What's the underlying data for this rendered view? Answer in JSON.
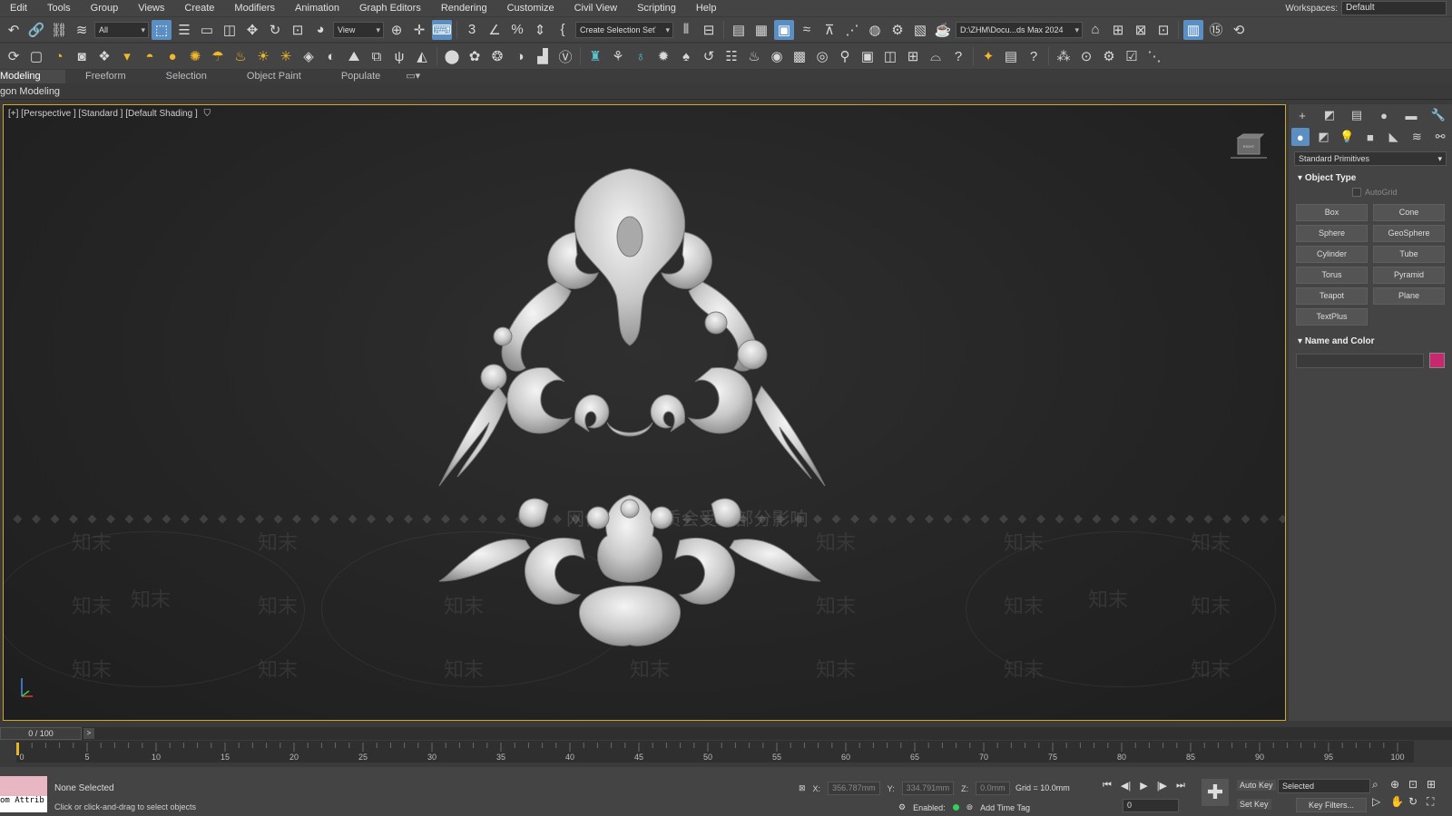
{
  "menu": [
    "Edit",
    "Tools",
    "Group",
    "Views",
    "Create",
    "Modifiers",
    "Animation",
    "Graph Editors",
    "Rendering",
    "Customize",
    "Civil View",
    "Scripting",
    "Help"
  ],
  "workspace": {
    "label": "Workspaces:",
    "value": "Default"
  },
  "toolbar": {
    "filter": "All",
    "coord_system": "View",
    "selection_set": "Create Selection Seť",
    "project_path": "D:\\ZHM\\Docu...ds Max 2024"
  },
  "ribbon": {
    "tabs": [
      "Modeling",
      "Freeform",
      "Selection",
      "Object Paint",
      "Populate"
    ],
    "sub": "gon Modeling"
  },
  "viewport": {
    "label": "[+] [Perspective ] [Standard ] [Default Shading ]",
    "watermark_main": "知末",
    "watermark_center": "网保护区  画质会受到部分影响",
    "viewcube_label": "RIGHT"
  },
  "command_panel": {
    "category": "Standard Primitives",
    "object_type_title": "Object Type",
    "autogrid": "AutoGrid",
    "primitives": [
      "Box",
      "Cone",
      "Sphere",
      "GeoSphere",
      "Cylinder",
      "Tube",
      "Torus",
      "Pyramid",
      "Teapot",
      "Plane",
      "TextPlus"
    ],
    "name_color_title": "Name and Color",
    "color": "#c8286e"
  },
  "timeline": {
    "frame_range": "0 / 100",
    "ticks": [
      "0",
      "5",
      "10",
      "15",
      "20",
      "25",
      "30",
      "35",
      "40",
      "45",
      "50",
      "55",
      "60",
      "65",
      "70",
      "75",
      "80",
      "85",
      "90",
      "95",
      "100"
    ]
  },
  "status": {
    "maxscript": "om Attrib",
    "selection": "None Selected",
    "prompt": "Click or click-and-drag to select objects",
    "x_label": "X:",
    "x_value": "356.787mm",
    "y_label": "Y:",
    "y_value": "334.791mm",
    "z_label": "Z:",
    "z_value": "0.0mm",
    "grid": "Grid = 10.0mm",
    "enabled_label": "Enabled:",
    "add_time_tag": "Add Time Tag",
    "frame": "0",
    "auto_key": "Auto Key",
    "set_key": "Set Key",
    "selected": "Selected",
    "key_filters": "Key Filters..."
  }
}
